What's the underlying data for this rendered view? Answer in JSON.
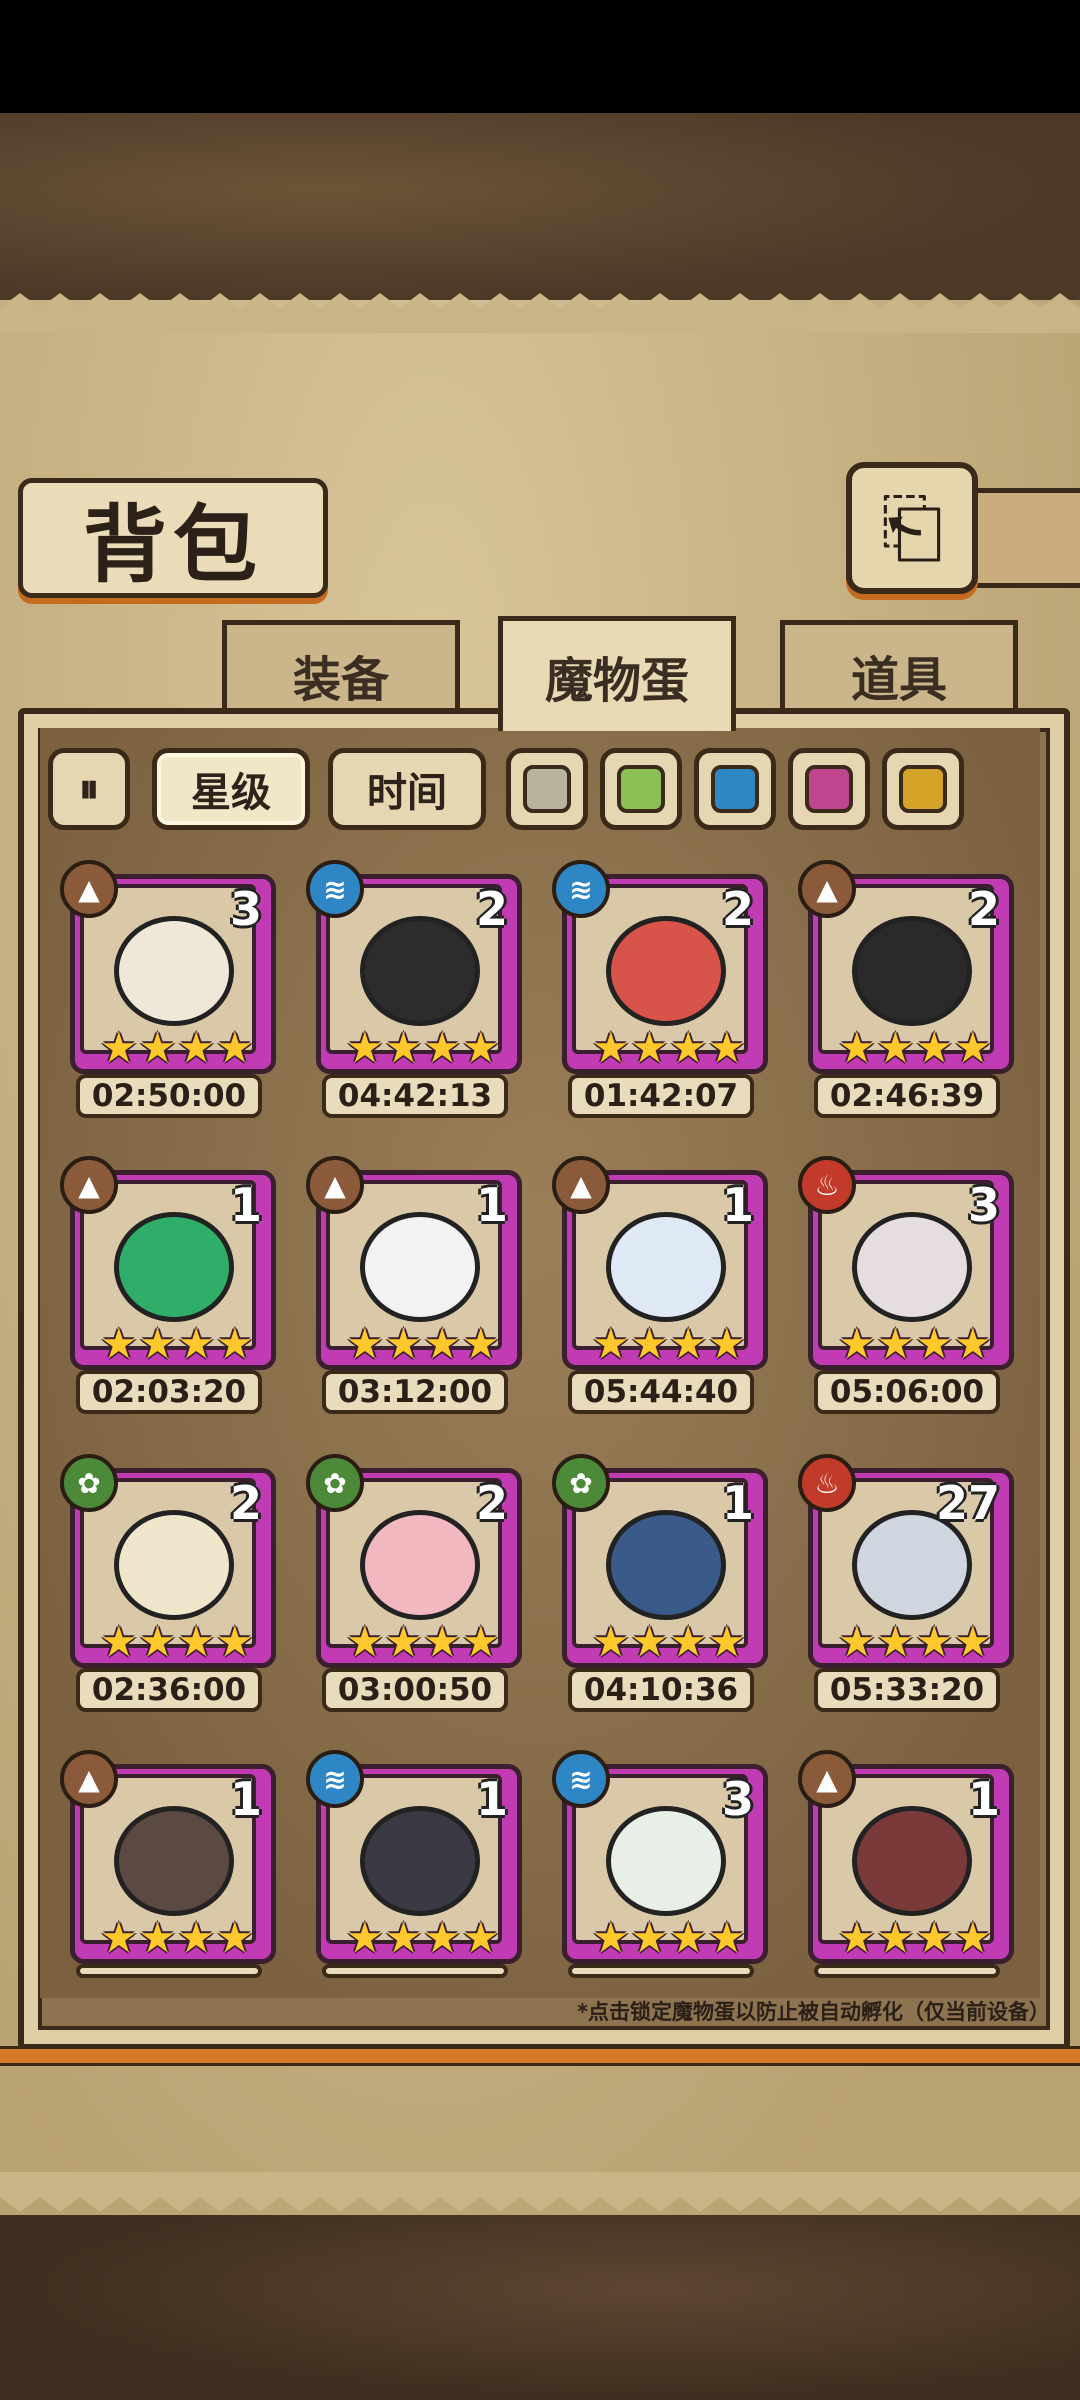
{
  "title": "背包",
  "back_icon": "back-arrow-icon",
  "tabs": [
    {
      "label": "装备",
      "active": false
    },
    {
      "label": "魔物蛋",
      "active": true
    },
    {
      "label": "道具",
      "active": false
    }
  ],
  "filters": {
    "toggle_icon": "pause-sort-icon",
    "star": "星级",
    "time": "时间",
    "swatches": [
      "#b9b29e",
      "#8cc056",
      "#2f86c4",
      "#c0458f",
      "#d4a328"
    ]
  },
  "eggs": [
    {
      "count": "3",
      "element": "earth",
      "timer": "02:50:00",
      "stars": 4
    },
    {
      "count": "2",
      "element": "water",
      "timer": "04:42:13",
      "stars": 4
    },
    {
      "count": "2",
      "element": "water",
      "timer": "01:42:07",
      "stars": 4
    },
    {
      "count": "2",
      "element": "earth",
      "timer": "02:46:39",
      "stars": 4
    },
    {
      "count": "1",
      "element": "earth",
      "timer": "02:03:20",
      "stars": 4
    },
    {
      "count": "1",
      "element": "earth",
      "timer": "03:12:00",
      "stars": 4
    },
    {
      "count": "1",
      "element": "earth",
      "timer": "05:44:40",
      "stars": 4
    },
    {
      "count": "3",
      "element": "fire",
      "timer": "05:06:00",
      "stars": 4
    },
    {
      "count": "2",
      "element": "wood",
      "timer": "02:36:00",
      "stars": 4
    },
    {
      "count": "2",
      "element": "wood",
      "timer": "03:00:50",
      "stars": 4
    },
    {
      "count": "1",
      "element": "wood",
      "timer": "04:10:36",
      "stars": 4
    },
    {
      "count": "27",
      "element": "fire",
      "timer": "05:33:20",
      "stars": 4
    },
    {
      "count": "1",
      "element": "earth",
      "timer": "",
      "stars": 4
    },
    {
      "count": "1",
      "element": "water",
      "timer": "",
      "stars": 4
    },
    {
      "count": "3",
      "element": "water",
      "timer": "",
      "stars": 4
    },
    {
      "count": "1",
      "element": "earth",
      "timer": "",
      "stars": 4
    }
  ],
  "note": "*点击锁定魔物蛋以防止被自动孵化（仅当前设备）"
}
